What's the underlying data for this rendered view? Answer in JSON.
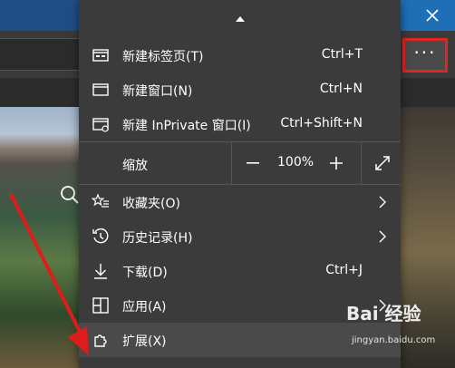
{
  "window": {
    "close_glyph": "✕"
  },
  "toolbar": {
    "more_label": "···"
  },
  "menu": {
    "scroll_up": "▲",
    "items": [
      {
        "label": "新建标签页(T)",
        "shortcut": "Ctrl+T",
        "icon": "new-tab-icon"
      },
      {
        "label": "新建窗口(N)",
        "shortcut": "Ctrl+N",
        "icon": "new-window-icon"
      },
      {
        "label": "新建 InPrivate 窗口(I)",
        "shortcut": "Ctrl+Shift+N",
        "icon": "inprivate-window-icon"
      }
    ],
    "zoom": {
      "label": "缩放",
      "value": "100%",
      "minus": "—",
      "plus": "+"
    },
    "items2": [
      {
        "label": "收藏夹(O)",
        "icon": "favorites-icon",
        "has_submenu": true
      },
      {
        "label": "历史记录(H)",
        "icon": "history-icon",
        "has_submenu": true
      },
      {
        "label": "下载(D)",
        "shortcut": "Ctrl+J",
        "icon": "download-icon"
      },
      {
        "label": "应用(A)",
        "icon": "apps-icon",
        "has_submenu": true
      },
      {
        "label": "扩展(X)",
        "icon": "extensions-icon"
      }
    ]
  },
  "watermark": {
    "brand": "Bai 经验",
    "url": "jingyan.baidu.com"
  },
  "colors": {
    "menu_bg": "#3b3b3b",
    "accent_red": "#e12424",
    "titlebar": "#1f6fb6"
  }
}
